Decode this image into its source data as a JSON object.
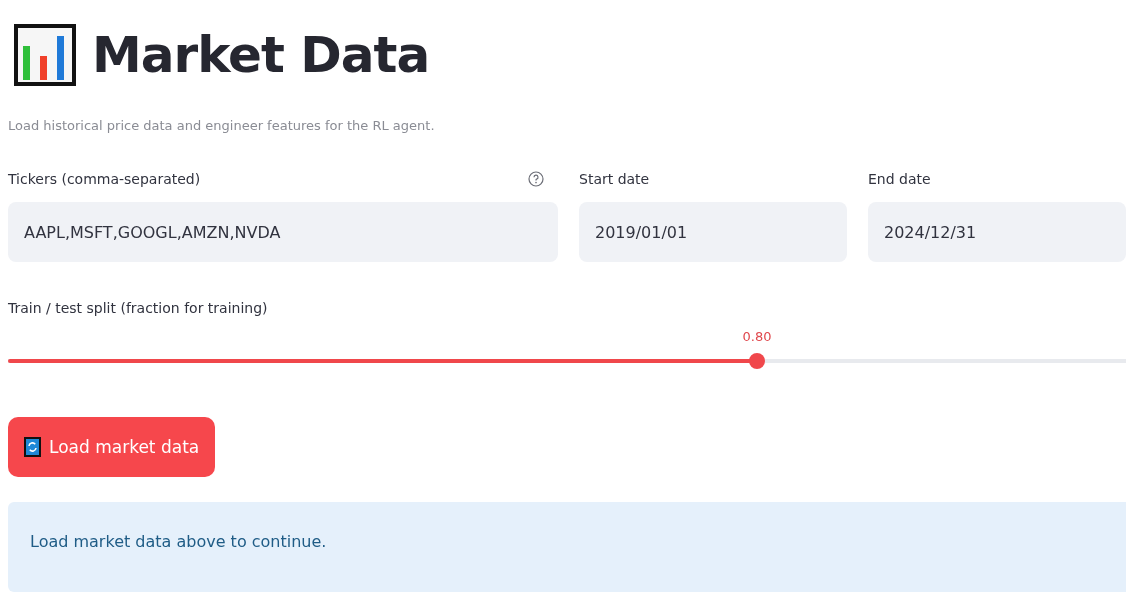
{
  "header": {
    "title": "Market Data",
    "caption": "Load historical price data and engineer features for the RL agent."
  },
  "fields": [
    {
      "label": "Tickers (comma-separated)",
      "value": "AAPL,MSFT,GOOGL,AMZN,NVDA",
      "help": true
    },
    {
      "label": "Start date",
      "value": "2019/01/01",
      "help": false
    },
    {
      "label": "End date",
      "value": "2024/12/31",
      "help": false
    }
  ],
  "slider": {
    "label": "Train / test split (fraction for training)",
    "reading": "0.80",
    "level": 0.67
  },
  "button": {
    "label": "Load market data"
  },
  "info": {
    "text": "Load market data above to continue."
  }
}
